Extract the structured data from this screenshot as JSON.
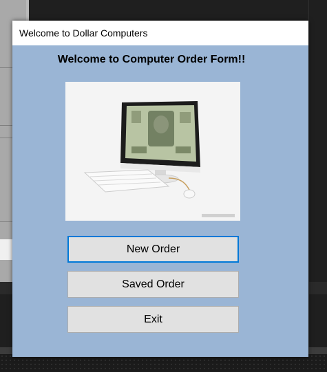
{
  "window": {
    "title": "Welcome to Dollar Computers",
    "background": "#9ab5d5"
  },
  "main": {
    "heading": "Welcome to Computer Order Form!!",
    "image_alt": "computer-with-dollar-screen-image",
    "buttons": [
      {
        "label": "New Order",
        "focused": true
      },
      {
        "label": "Saved Order",
        "focused": false
      },
      {
        "label": "Exit",
        "focused": false
      }
    ]
  },
  "colors": {
    "focus_border": "#0078d7",
    "button_bg": "#e1e1e1"
  }
}
